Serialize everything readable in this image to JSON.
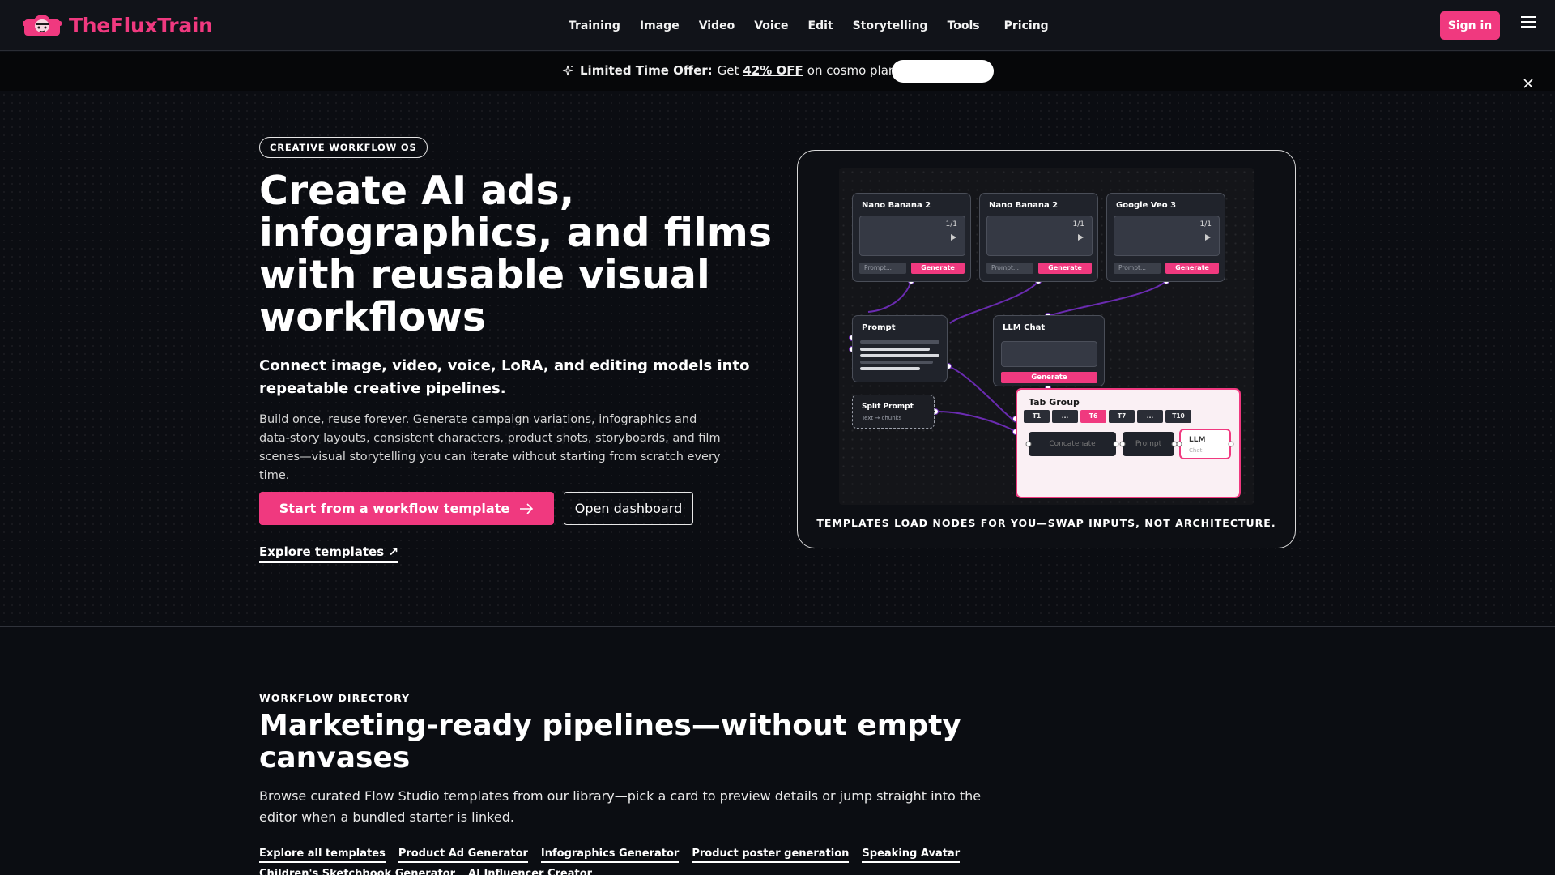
{
  "brand": {
    "name": "TheFluxTrain",
    "color": "#f0397f"
  },
  "nav": {
    "links": [
      "Training",
      "Image",
      "Video",
      "Voice",
      "Edit",
      "Storytelling",
      "Tools",
      "Pricing"
    ],
    "signin_label": "Sign in",
    "menu_icon": "hamburger-icon"
  },
  "promo": {
    "icon": "sparkle-icon",
    "lead": "Limited Time Offer:",
    "get": "Get",
    "discount": "42% OFF",
    "rest": "on cosmo plan!",
    "close_icon": "close-icon"
  },
  "hero": {
    "badge": "CREATIVE WORKFLOW OS",
    "title": "Create AI ads, infographics, and films with reusable visual workflows",
    "subtitle": "Connect image, video, voice, LoRA, and editing models into repeatable creative pipelines.",
    "description": "Build once, reuse forever. Generate campaign variations, infographics and data-story layouts, consistent characters, product shots, storyboards, and film scenes—visual storytelling you can iterate without starting from scratch every time.",
    "primary_cta": "Start from a workflow template",
    "secondary_cta": "Open dashboard",
    "explore_link": "Explore templates ↗"
  },
  "workflow": {
    "caption": "TEMPLATES LOAD NODES FOR YOU—SWAP INPUTS, NOT ARCHITECTURE.",
    "gen_nodes": [
      {
        "title": "Nano Banana 2",
        "count": "1/1",
        "prompt": "Prompt...",
        "generate": "Generate"
      },
      {
        "title": "Nano Banana 2",
        "count": "1/1",
        "prompt": "Prompt...",
        "generate": "Generate"
      },
      {
        "title": "Google Veo 3",
        "count": "1/1",
        "prompt": "Prompt...",
        "generate": "Generate"
      }
    ],
    "prompt_node": {
      "title": "Prompt"
    },
    "llm_node": {
      "title": "LLM Chat",
      "generate": "Generate"
    },
    "split_node": {
      "title": "Split Prompt",
      "sub": "Text → chunks"
    },
    "tab_group": {
      "title": "Tab Group",
      "tabs": [
        "T1",
        "...",
        "T6",
        "T7",
        "...",
        "T10"
      ],
      "active_tab": "T6",
      "inner": [
        "Concatenate",
        "Prompt"
      ],
      "llm_title": "LLM",
      "llm_sub": "Chat"
    },
    "accent": "#f0397f",
    "wire": "#6a2bb0"
  },
  "directory": {
    "kicker": "WORKFLOW DIRECTORY",
    "title": "Marketing-ready pipelines—without empty canvases",
    "description": "Browse curated Flow Studio templates from our library—pick a card to preview details or jump straight into the editor when a bundled starter is linked.",
    "links": [
      "Explore all templates",
      "Product Ad Generator",
      "Infographics Generator",
      "Product poster generation",
      "Speaking Avatar",
      "Children's Sketchbook Generator",
      "AI Influencer Creator"
    ]
  }
}
